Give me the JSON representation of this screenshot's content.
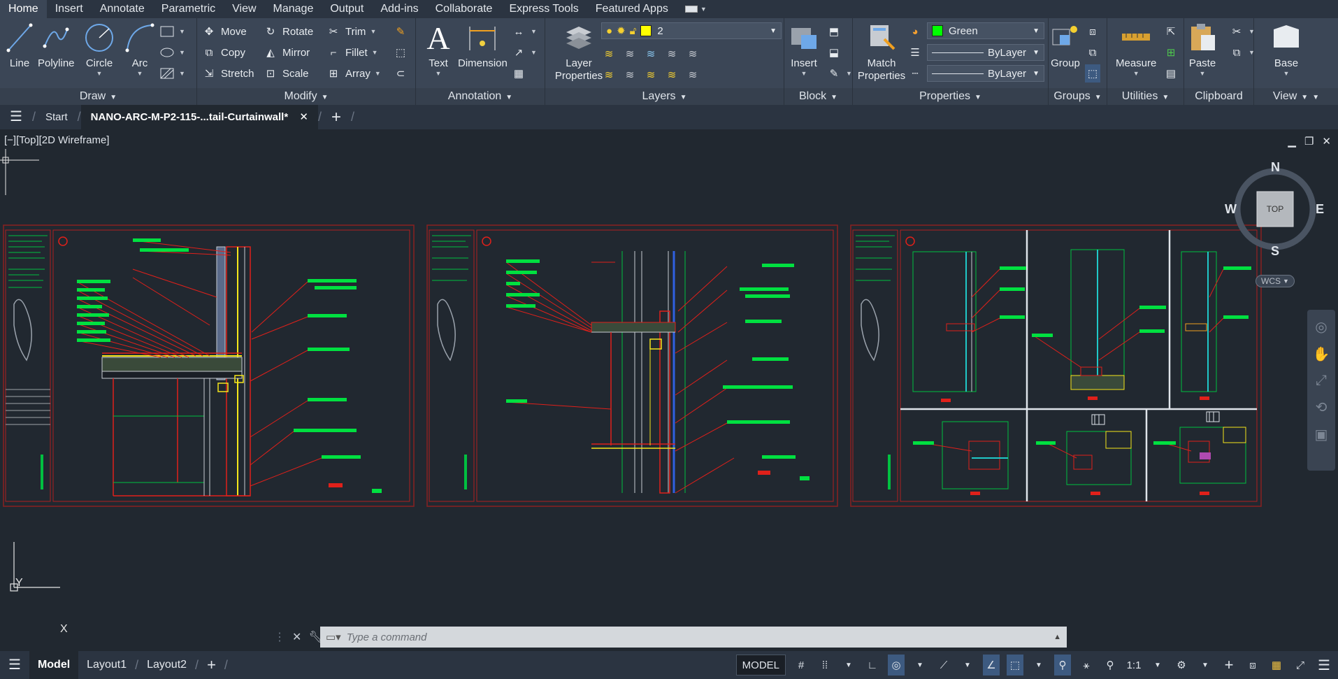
{
  "menu": {
    "tabs": [
      "Home",
      "Insert",
      "Annotate",
      "Parametric",
      "View",
      "Manage",
      "Output",
      "Add-ins",
      "Collaborate",
      "Express Tools",
      "Featured Apps"
    ],
    "active": "Home"
  },
  "ribbon": {
    "draw": {
      "title": "Draw",
      "line": "Line",
      "polyline": "Polyline",
      "circle": "Circle",
      "arc": "Arc"
    },
    "modify": {
      "title": "Modify",
      "move": "Move",
      "rotate": "Rotate",
      "trim": "Trim",
      "copy": "Copy",
      "mirror": "Mirror",
      "fillet": "Fillet",
      "stretch": "Stretch",
      "scale": "Scale",
      "array": "Array"
    },
    "annotation": {
      "title": "Annotation",
      "text": "Text",
      "dimension": "Dimension"
    },
    "layers": {
      "title": "Layers",
      "layer_properties": "Layer Properties",
      "current_layer": "2",
      "current_layer_color": "#ffff00"
    },
    "block": {
      "title": "Block",
      "insert": "Insert"
    },
    "properties": {
      "title": "Properties",
      "match": "Match Properties",
      "color": "Green",
      "color_hex": "#00ff00",
      "linetype": "ByLayer",
      "lineweight": "ByLayer"
    },
    "groups": {
      "title": "Groups",
      "group": "Group"
    },
    "utilities": {
      "title": "Utilities",
      "measure": "Measure"
    },
    "clipboard": {
      "title": "Clipboard",
      "paste": "Paste"
    },
    "view": {
      "title": "View",
      "base": "Base"
    }
  },
  "filetabs": {
    "start": "Start",
    "document": "NANO-ARC-M-P2-115-...tail-Curtainwall*"
  },
  "viewport": {
    "label": "[−][Top][2D Wireframe]",
    "viewcube": {
      "n": "N",
      "s": "S",
      "e": "E",
      "w": "W",
      "top": "TOP",
      "wcs": "WCS"
    },
    "ucs": {
      "y": "Y",
      "x": "X"
    }
  },
  "command": {
    "placeholder": "Type a command"
  },
  "status": {
    "tabs": [
      "Model",
      "Layout1",
      "Layout2"
    ],
    "active": "Model",
    "model_button": "MODEL",
    "scale": "1:1"
  },
  "colors": {
    "drawing_red": "#e0201a",
    "drawing_green": "#00e040",
    "drawing_yellow": "#f5e61a",
    "drawing_cyan": "#20c8c8"
  }
}
